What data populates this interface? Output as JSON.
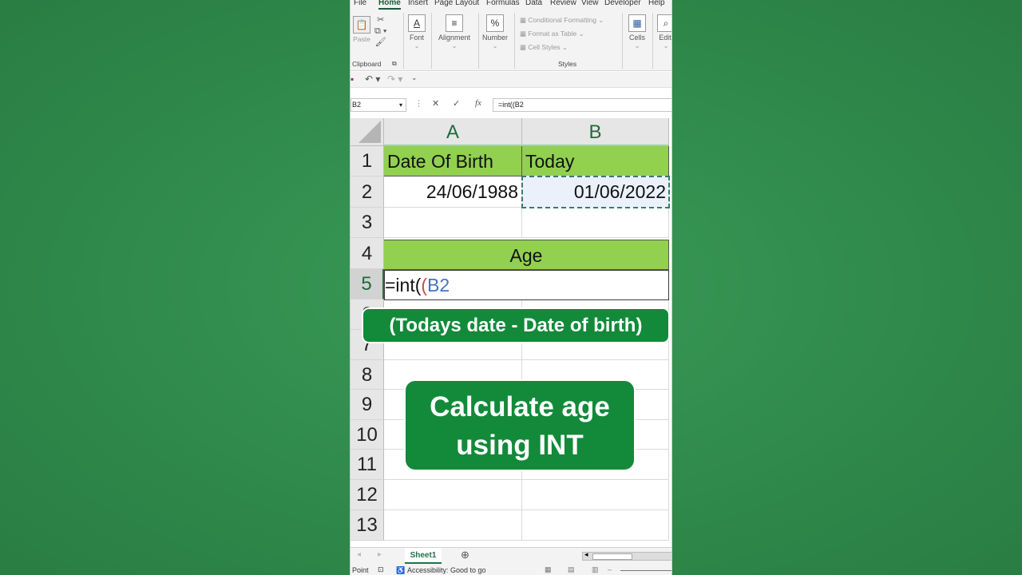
{
  "ribbon_tabs": [
    "File",
    "Home",
    "Insert",
    "Page Layout",
    "Formulas",
    "Data",
    "Review",
    "View",
    "Developer",
    "Help"
  ],
  "ribbon": {
    "clipboard": {
      "paste": "Paste",
      "label": "Clipboard"
    },
    "font": "Font",
    "alignment": "Alignment",
    "number": "Number",
    "styles": {
      "conditional": "Conditional Formatting",
      "format_table": "Format as Table",
      "cell_styles": "Cell Styles",
      "label": "Styles"
    },
    "cells": "Cells",
    "editing": "Editi"
  },
  "formula_bar": {
    "name_box": "B2",
    "formula": "=int((B2"
  },
  "columns": [
    "A",
    "B"
  ],
  "rows": [
    "1",
    "2",
    "3",
    "4",
    "5",
    "6",
    "7",
    "8",
    "9",
    "10",
    "11",
    "12",
    "13"
  ],
  "cells": {
    "a1": "Date Of Birth",
    "b1": "Today",
    "a2": "24/06/1988",
    "b2": "01/06/2022",
    "a4": "Age",
    "a5_prefix": "=int(",
    "a5_paren": "(",
    "a5_ref": "B2"
  },
  "overlay": {
    "hint": "(Todays date - Date of birth)",
    "title_line1": "Calculate age",
    "title_line2": "using INT"
  },
  "sheet_tab": "Sheet1",
  "status": {
    "mode": "Point",
    "accessibility": "Accessibility: Good to go"
  },
  "colors": {
    "header_fill": "#92d050",
    "excel_green": "#217346",
    "pill": "#128a3a",
    "background": "#2f8a4b"
  }
}
